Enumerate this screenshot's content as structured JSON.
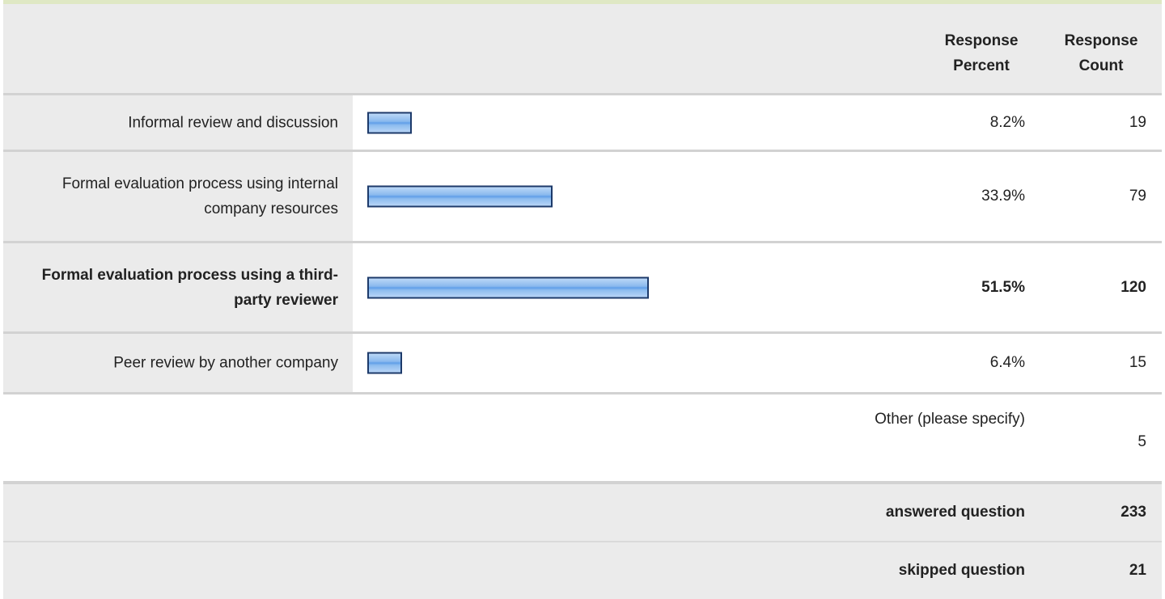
{
  "chart_data": {
    "type": "bar",
    "orientation": "horizontal",
    "columns": {
      "percent_header": "Response Percent",
      "count_header": "Response Count"
    },
    "categories": [
      "Informal review and discussion",
      "Formal evaluation process using internal company resources",
      "Formal evaluation process using a third-party reviewer",
      "Peer review by another company"
    ],
    "percent_values": [
      8.2,
      33.9,
      51.5,
      6.4
    ],
    "percent_labels": [
      "8.2%",
      "33.9%",
      "51.5%",
      "6.4%"
    ],
    "counts": [
      "19",
      "79",
      "120",
      "15"
    ],
    "highlighted_index": 2,
    "bar_color": "#7fb2ec",
    "bar_border_color": "#1d3a6a",
    "other": {
      "label": "Other (please specify)",
      "count": "5"
    },
    "summary": {
      "answered_label": "answered question",
      "answered_value": "233",
      "skipped_label": "skipped question",
      "skipped_value": "21"
    }
  },
  "colors": {
    "header_bg": "#ebebeb",
    "top_accent": "#dfe8c4",
    "separator": "#d2d2d2"
  }
}
